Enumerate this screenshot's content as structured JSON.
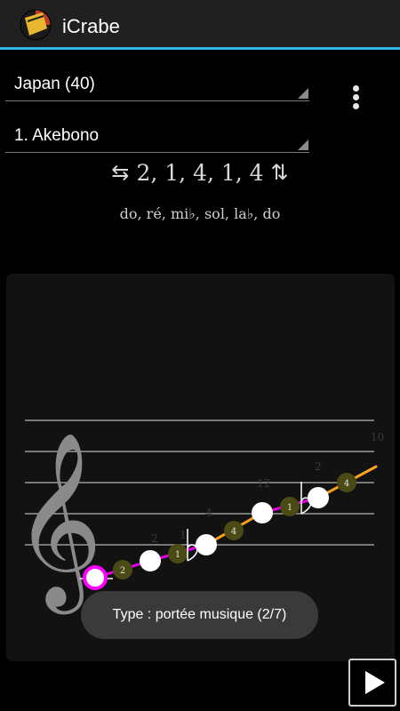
{
  "app": {
    "title": "iCrabe",
    "colors": {
      "accent": "#33b5e5",
      "action_bar": "#202020"
    }
  },
  "selectors": {
    "country": "Japan (40)",
    "song": "1. Akebono"
  },
  "menu": {
    "icon": "overflow-vertical-icon"
  },
  "sequence": {
    "swap_icon": "⇆",
    "intervals": "2, 1, 4, 1, 4",
    "sort_icon": "⇅"
  },
  "notes_text": "do, ré, mi♭, sol, la♭, do",
  "staff": {
    "clef": "𝄞",
    "clef_icon": "treble-clef-icon",
    "notes": [
      "do",
      "ré",
      "mi♭",
      "sol",
      "la♭",
      "do"
    ],
    "interval_labels": [
      "2",
      "1",
      "4",
      "1",
      "4"
    ],
    "top_labels": [
      "2",
      "1",
      "4",
      "12",
      "2",
      "10"
    ],
    "colors": {
      "magenta": "#e000e0",
      "orange": "#ffa020",
      "olive": "#4a4a14",
      "first_note_ring": "#ff00ff"
    }
  },
  "toast": {
    "text": "Type : portée musique (2/7)"
  },
  "play": {
    "icon": "play-icon"
  }
}
